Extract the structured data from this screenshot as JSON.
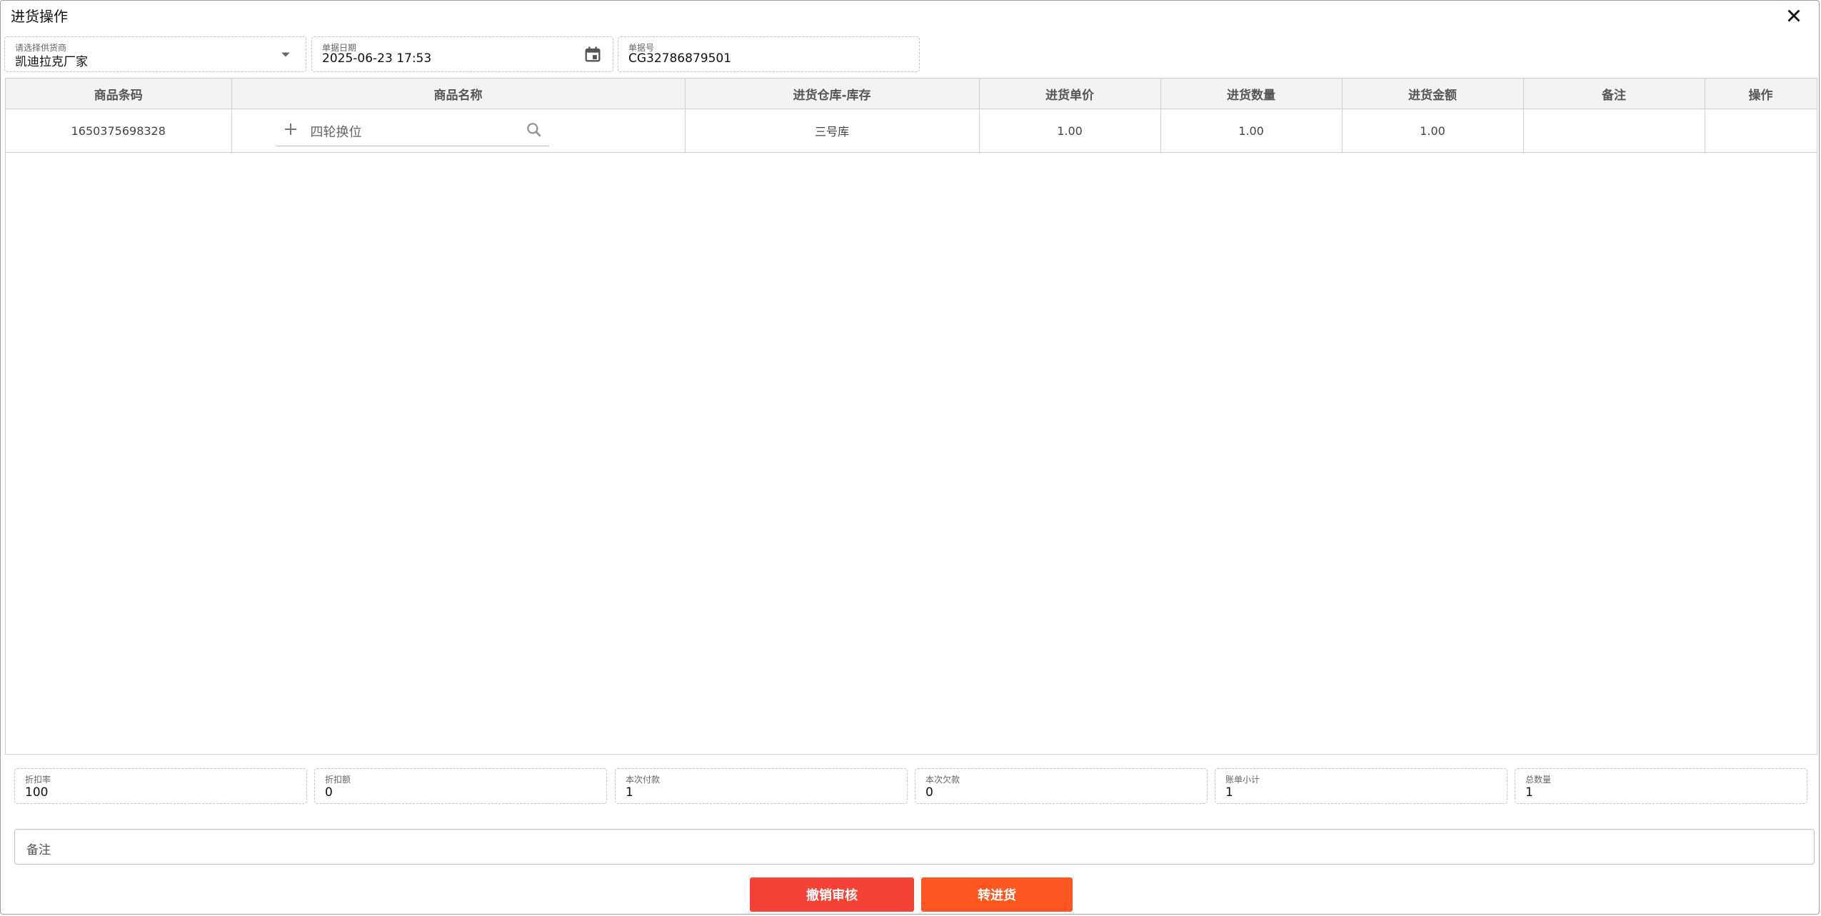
{
  "dialog": {
    "title": "进货操作"
  },
  "header": {
    "supplier": {
      "label": "请选择供货商",
      "value": "凯迪拉克厂家"
    },
    "doc_date": {
      "label": "单据日期",
      "value": "2025-06-23 17:53"
    },
    "doc_no": {
      "label": "单据号",
      "value": "CG32786879501"
    }
  },
  "table": {
    "columns": [
      "商品条码",
      "商品名称",
      "进货仓库-库存",
      "进货单价",
      "进货数量",
      "进货金额",
      "备注",
      "操作"
    ],
    "rows": [
      {
        "barcode": "1650375698328",
        "name": "四轮换位",
        "warehouse": "三号库",
        "unit_price": "1.00",
        "quantity": "1.00",
        "amount": "1.00",
        "remark": "",
        "action": ""
      }
    ]
  },
  "summary": {
    "discount_rate": {
      "label": "折扣率",
      "value": "100"
    },
    "discount_amount": {
      "label": "折扣额",
      "value": "0"
    },
    "payment": {
      "label": "本次付款",
      "value": "1"
    },
    "debt": {
      "label": "本次欠款",
      "value": "0"
    },
    "subtotal": {
      "label": "账单小计",
      "value": "1"
    },
    "total_qty": {
      "label": "总数量",
      "value": "1"
    }
  },
  "remark": {
    "placeholder": "备注"
  },
  "actions": {
    "revoke": "撤销审核",
    "transfer": "转进货"
  },
  "colors": {
    "revoke": "#f44336",
    "transfer": "#ff5722"
  },
  "icons": [
    "close-icon",
    "dropdown-icon",
    "calendar-icon",
    "plus-icon",
    "search-icon"
  ]
}
